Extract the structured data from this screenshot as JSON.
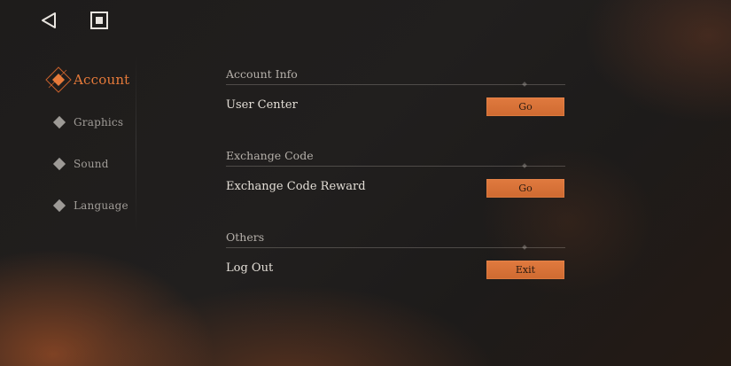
{
  "nav": {
    "back_icon": "back-triangle-icon",
    "stop_icon": "stop-square-icon"
  },
  "sidebar": {
    "items": [
      {
        "label": "Account",
        "active": true
      },
      {
        "label": "Graphics",
        "active": false
      },
      {
        "label": "Sound",
        "active": false
      },
      {
        "label": "Language",
        "active": false
      }
    ]
  },
  "sections": [
    {
      "title": "Account Info",
      "row_label": "User Center",
      "button_label": "Go"
    },
    {
      "title": "Exchange Code",
      "row_label": "Exchange Code Reward",
      "button_label": "Go"
    },
    {
      "title": "Others",
      "row_label": "Log Out",
      "button_label": "Exit"
    }
  ],
  "colors": {
    "accent": "#e07a3f",
    "active_text": "#e67a3a",
    "background": "#1f1d1c"
  }
}
